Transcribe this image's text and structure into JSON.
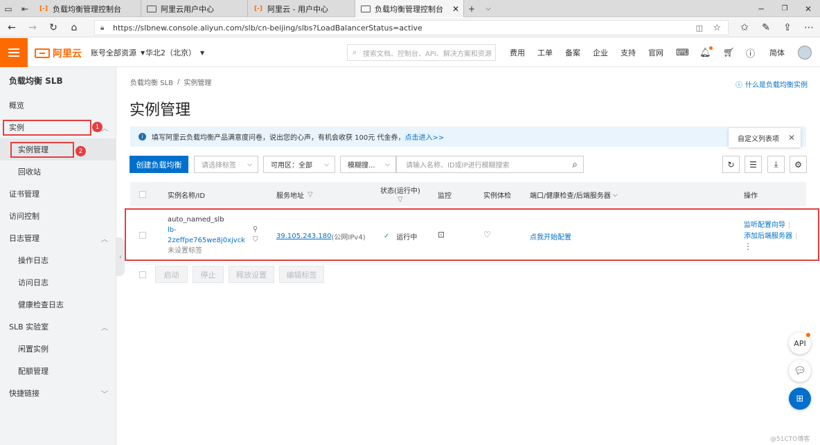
{
  "browser": {
    "tabs": [
      {
        "title": "负载均衡管理控制台"
      },
      {
        "title": "阿里云用户中心"
      },
      {
        "title": "阿里云 - 用户中心"
      },
      {
        "title": "负载均衡管理控制台"
      }
    ],
    "url": "https://slbnew.console.aliyun.com/slb/cn-beijing/slbs?LoadBalancerStatus=active"
  },
  "topbar": {
    "logo_text": "阿里云",
    "resource_group": "账号全部资源",
    "region": "华北2（北京）",
    "search_placeholder": "搜索文档、控制台、API、解决方案和资源",
    "links": [
      "费用",
      "工单",
      "备案",
      "企业",
      "支持",
      "官网"
    ],
    "language": "简体"
  },
  "sidebar": {
    "title": "负载均衡 SLB",
    "items": [
      {
        "label": "概览"
      },
      {
        "label": "实例"
      },
      {
        "label": "实例管理"
      },
      {
        "label": "回收站"
      },
      {
        "label": "证书管理"
      },
      {
        "label": "访问控制"
      },
      {
        "label": "日志管理"
      },
      {
        "label": "操作日志"
      },
      {
        "label": "访问日志"
      },
      {
        "label": "健康检查日志"
      },
      {
        "label": "SLB 实验室"
      },
      {
        "label": "闲置实例"
      },
      {
        "label": "配额管理"
      },
      {
        "label": "快捷链接"
      }
    ]
  },
  "annotations": {
    "badge1": "1",
    "badge2": "2"
  },
  "main": {
    "breadcrumb": [
      "负载均衡 SLB",
      "/",
      "实例管理"
    ],
    "help_link": "什么是负载均衡实例",
    "page_title": "实例管理",
    "notice_text": "填写阿里云负载均衡产品满意度问卷，说出您的心声，有机会收获 100元 代金券，",
    "notice_link": "点击进入>>",
    "custom_columns_tooltip": "自定义列表项",
    "toolbar": {
      "create_button": "创建负载均衡",
      "tag_select_placeholder": "请选择标签",
      "zone_select": "可用区：全部",
      "search_mode": "模糊搜...",
      "search_placeholder": "请输入名称、ID或IP进行模糊搜索"
    },
    "table": {
      "headers": {
        "name": "实例名称/ID",
        "address": "服务地址",
        "status": "状态(运行中)",
        "monitor": "监控",
        "health": "实例体检",
        "ports": "端口/健康检查/后端服务器",
        "actions": "操作"
      },
      "rows": [
        {
          "name": "auto_named_slb",
          "id_line1": "lb-",
          "id_line2": "2zeffpe765we8j0xjvck",
          "tags": "未设置标签",
          "address": "39.105.243.180",
          "address_type": "(公网IPv4)",
          "status": "运行中",
          "ports_link": "点我开始配置",
          "action1": "监听配置向导",
          "action2": "添加后端服务器"
        }
      ]
    },
    "batch_buttons": [
      "启动",
      "停止",
      "释放设置",
      "编辑标签"
    ]
  },
  "floating": {
    "api_label": "API"
  },
  "watermark": "@51CTO博客"
}
